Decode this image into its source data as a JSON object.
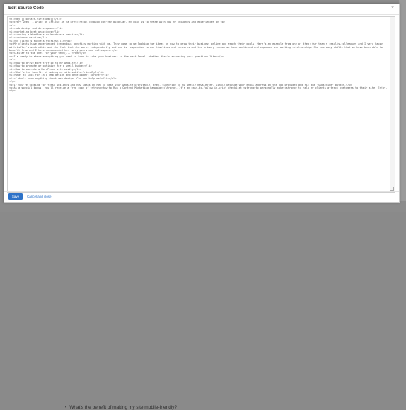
{
  "dialog": {
    "title": "Edit Source Code",
    "close_icon": "×"
  },
  "editor": {
    "lines": [
      "<h1>Hey [[contact.firstname]]</h1>",
      "<p>Every week, I write an article at <a href=\"http://myblog.com\">my blog</a>. My goal is to share with you my thoughts and experiences on <p>",
      "<ol>",
      "<li>web design and development</li>",
      "<li>marketing best practices</li>",
      "<li>running a WordPress or Wordpress website</li>",
      "<li>customer service</li>",
      "<li>my client's success stories</li></ol>",
      "<p>My clients have experienced tremendous benefits working with me. They come to me looking for ideas on how to grow their business online and reach their goals. Here's an example from one of them: Our team's results-colleagues and I very happy with Ashley's work ethic and the fact that she works independently and she is responsive to our timelines and concerns and the primary reason we have continued and expanded our working relationship. She has many skills that we have been able to benefit from and I have recommended her to my peers and colleagues.</p>",
      "<p>Similar to the ones for your <em>(...)</em></p>",
      "<p>I'm ready to share everything you need to know to take your business to the next level, whether that's answering your questions like:</p>",
      "<ol>",
      "<li>How to drive more traffic to my website</li>",
      "<li>How to promote or optimize for a small budget</li>",
      "<li>How to operate a WordPress site easily</li>",
      "<li>What's the benefit of making my site mobile-friendly?</li>",
      "<li>What to look for in a web design and development partner</li>",
      "<li>I don't know anything about web design. Can you help me?</li></ol>",
      "</p>",
      "<p>If you're looking for fresh insights and new ideas on how to make your website profitable, then, subscribe to my weekly newsletter. Simply provide your email address in the box provided and hit the \"Subscribe\" button.</p>",
      "<p>As a special bonus, you'll receive a free copy of <strong>How to Run a Content Marketing Campaign</strong>. It's an easy-to-follow in-print checklist <strong>to personally make</strong> to help my clients attract customers to their site. Enjoy.</p>"
    ]
  },
  "footer": {
    "save_label": "Save",
    "cancel_label": "Cancel and close"
  },
  "background": {
    "visible_bullet": "What's the benefit of making my site mobile-friendly?"
  }
}
